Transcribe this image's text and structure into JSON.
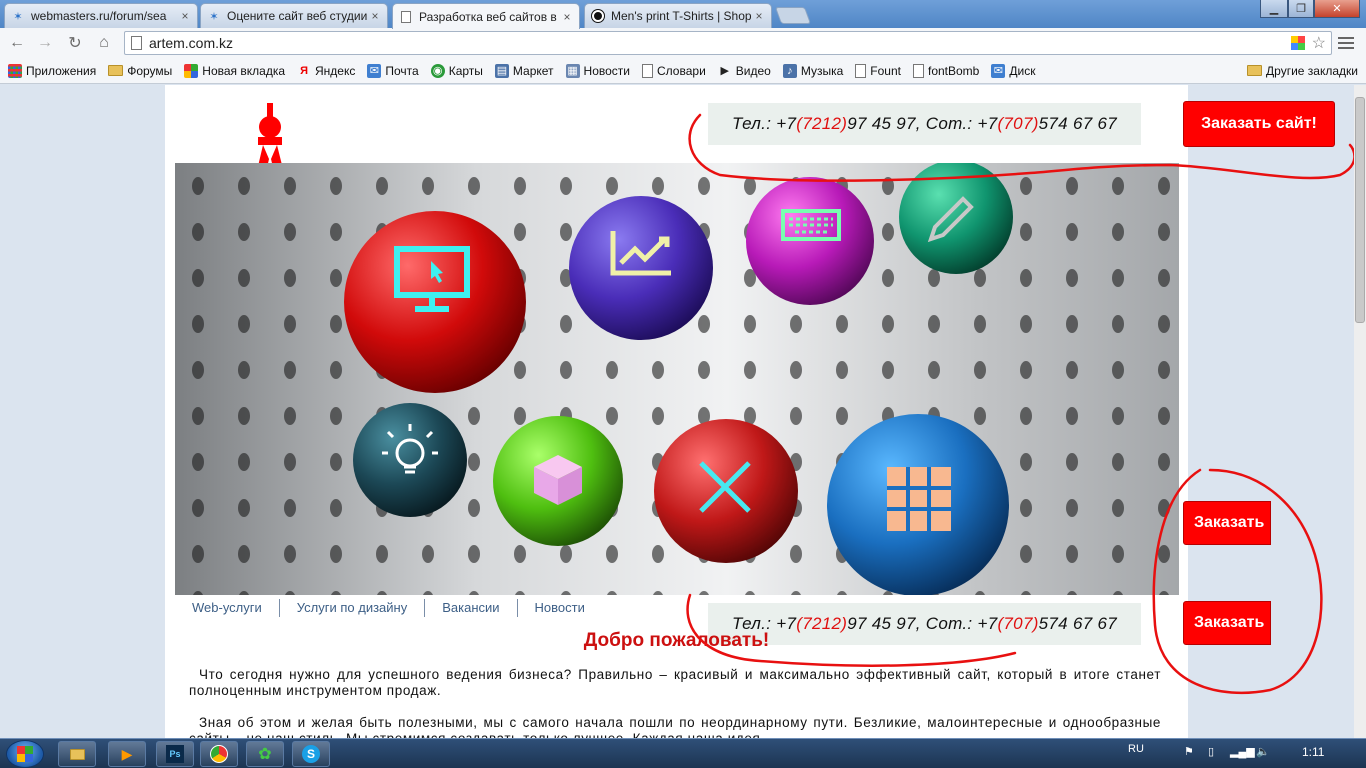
{
  "browser": {
    "tabs": [
      {
        "title": "webmasters.ru/forum/sea",
        "active": false
      },
      {
        "title": "Оцените сайт веб студии",
        "active": false
      },
      {
        "title": "Разработка веб сайтов в",
        "active": true
      },
      {
        "title": "Men's print T-Shirts | Shop",
        "active": false
      }
    ],
    "address": "artem.com.kz",
    "bookmarks": [
      {
        "label": "Приложения",
        "icon": "apps-grid-icon"
      },
      {
        "label": "Форумы",
        "icon": "folder-icon"
      },
      {
        "label": "Новая вкладка",
        "icon": "windows-flag-icon"
      },
      {
        "label": "Яндекс",
        "icon": "yandex-icon"
      },
      {
        "label": "Почта",
        "icon": "mail-icon"
      },
      {
        "label": "Карты",
        "icon": "maps-icon"
      },
      {
        "label": "Маркет",
        "icon": "market-icon"
      },
      {
        "label": "Новости",
        "icon": "news-icon"
      },
      {
        "label": "Словари",
        "icon": "page-icon"
      },
      {
        "label": "Видео",
        "icon": "video-icon"
      },
      {
        "label": "Музыка",
        "icon": "music-icon"
      },
      {
        "label": "Fount",
        "icon": "page-icon"
      },
      {
        "label": "fontBomb",
        "icon": "page-icon"
      },
      {
        "label": "Диск",
        "icon": "disk-icon"
      }
    ],
    "other_bookmarks": "Другие закладки"
  },
  "site": {
    "phone": {
      "prefix": "Тел.: +7 ",
      "code1": "(7212)",
      "num1": " 97 45 97, Сот.: +7 ",
      "code2": "(707)",
      "num2": " 574 67 67"
    },
    "order_button": "Заказать сайт!",
    "order_button_short": "Заказать",
    "nav": [
      "Web-услуги",
      "Услуги по дизайну",
      "Вакансии",
      "Новости"
    ],
    "welcome": "Добро пожаловать!",
    "paragraphs": [
      "Что сегодня нужно для успешного ведения бизнеса? Правильно – красивый и максимально эффективный сайт, который в итоге станет полноценным инструментом продаж.",
      "Зная об этом и желая быть полезными, мы с самого начала пошли по неординарному пути. Безликие, малоинтересные и однообразные сайты – не наш стиль. Мы стремимся создавать только лучшее. Каждая наша идея"
    ]
  },
  "taskbar": {
    "lang": "RU",
    "time": "1:11"
  },
  "colors": {
    "accent_red": "#ff0000",
    "nav_link": "#3d5f86",
    "welcome": "#cc1010"
  }
}
